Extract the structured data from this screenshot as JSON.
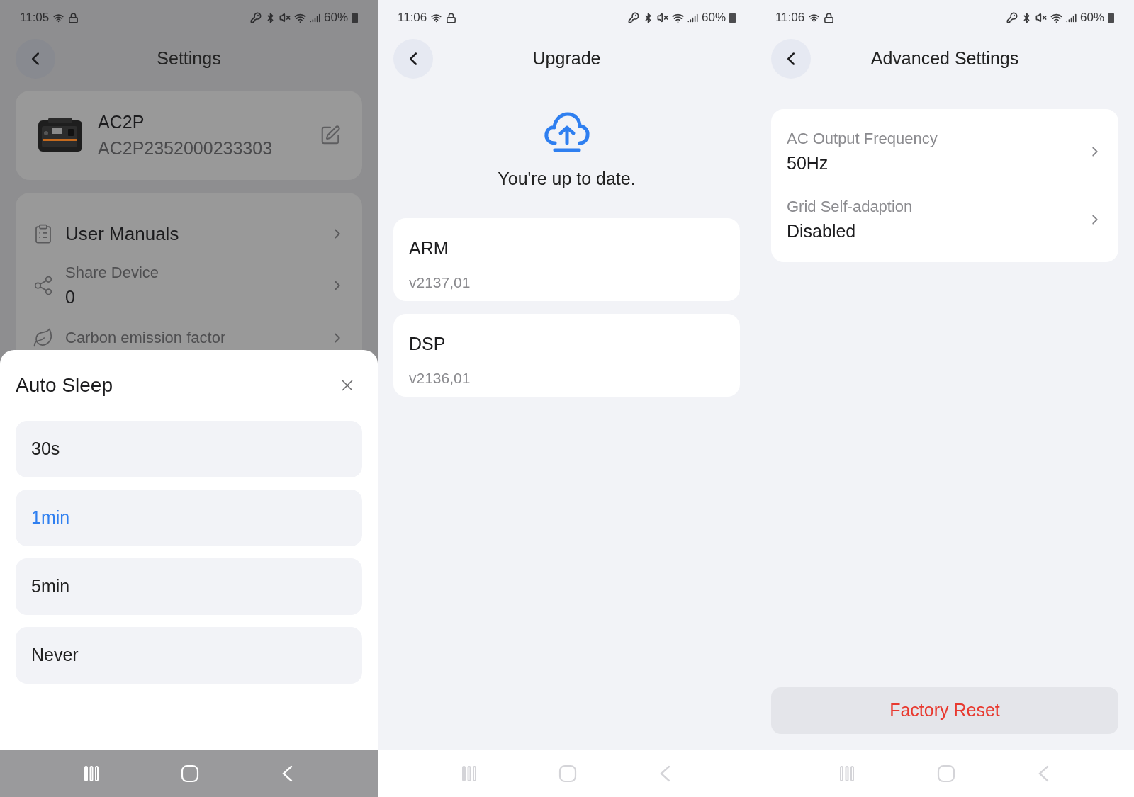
{
  "settings_screen": {
    "status_bar": {
      "time": "11:05",
      "battery": "60%"
    },
    "title": "Settings",
    "device": {
      "name": "AC2P",
      "serial": "AC2P2352000233303"
    },
    "menu": [
      {
        "kind": "title",
        "label": "User Manuals"
      },
      {
        "kind": "field",
        "label": "Share Device",
        "value": "0"
      },
      {
        "kind": "field",
        "label": "Carbon emission factor"
      }
    ],
    "sheet": {
      "title": "Auto Sleep",
      "options": [
        {
          "label": "30s",
          "selected": false
        },
        {
          "label": "1min",
          "selected": true
        },
        {
          "label": "5min",
          "selected": false
        },
        {
          "label": "Never",
          "selected": false
        }
      ]
    }
  },
  "upgrade_screen": {
    "status_bar": {
      "time": "11:06",
      "battery": "60%"
    },
    "title": "Upgrade",
    "message": "You're up to date.",
    "modules": [
      {
        "name": "ARM",
        "version": "v2137,01"
      },
      {
        "name": "DSP",
        "version": "v2136,01"
      }
    ]
  },
  "advanced_screen": {
    "status_bar": {
      "time": "11:06",
      "battery": "60%"
    },
    "title": "Advanced Settings",
    "settings": [
      {
        "label": "AC Output Frequency",
        "value": "50Hz"
      },
      {
        "label": "Grid Self-adaption",
        "value": "Disabled"
      }
    ],
    "reset_button": "Factory Reset"
  }
}
